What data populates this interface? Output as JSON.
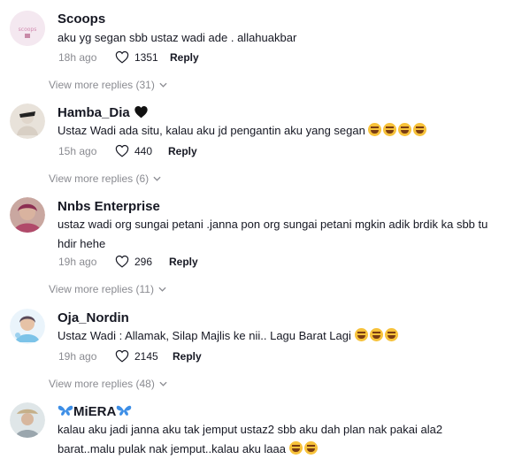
{
  "comments": [
    {
      "name": "Scoops",
      "text": "aku yg segan sbb ustaz wadi ade . allahuakbar",
      "time": "18h ago",
      "likes": "1351",
      "reply": "Reply",
      "more": "View more replies (31)",
      "emoji_count": 0
    },
    {
      "name": "Hamba_Dia",
      "text": "Ustaz Wadi ada situ, kalau aku jd pengantin aku yang segan",
      "time": "15h ago",
      "likes": "440",
      "reply": "Reply",
      "more": "View more replies (6)",
      "emoji_count": 4
    },
    {
      "name": "Nnbs Enterprise",
      "text": "ustaz wadi org sungai petani .janna pon org sungai petani mgkin adik brdik ka sbb tu hdir hehe",
      "time": "19h ago",
      "likes": "296",
      "reply": "Reply",
      "more": "View more replies (11)",
      "emoji_count": 0
    },
    {
      "name": "Oja_Nordin",
      "text": "Ustaz Wadi : Allamak, Silap Majlis ke nii.. Lagu Barat Lagi",
      "time": "19h ago",
      "likes": "2145",
      "reply": "Reply",
      "more": "View more replies (48)",
      "emoji_count": 3
    },
    {
      "name": "MiERA",
      "text": "kalau aku jadi janna aku tak jemput ustaz2 sbb aku dah plan nak pakai ala2 barat..malu pulak nak jemput..kalau aku laaa",
      "emoji_count": 2
    }
  ]
}
